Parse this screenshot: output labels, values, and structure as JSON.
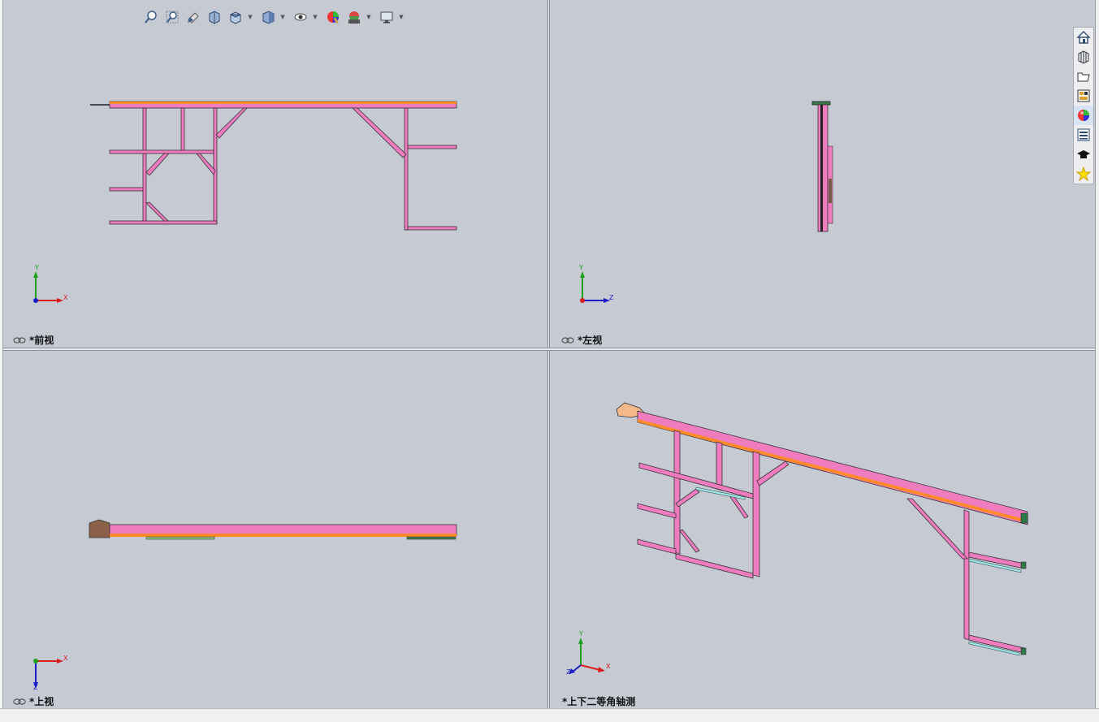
{
  "viewports": {
    "front": {
      "label": "*前视",
      "axis_h": "X",
      "axis_v": "Y"
    },
    "left": {
      "label": "*左视",
      "axis_h": "Z",
      "axis_v": "Y"
    },
    "top": {
      "label": "*上视",
      "axis_h": "X",
      "axis_v": "Z"
    },
    "iso": {
      "label": "*上下二等角轴测",
      "axis_x": "X",
      "axis_y": "Y",
      "axis_z": "Z"
    }
  },
  "toolbar": {
    "icons": [
      "zoom-to-fit-icon",
      "zoom-to-area-icon",
      "previous-view-icon",
      "section-view-icon",
      "view-orientation-icon",
      "display-style-icon",
      "hide-show-items-icon",
      "edit-appearance-icon",
      "apply-scene-icon",
      "view-settings-icon"
    ]
  },
  "task_pane": {
    "icons": [
      "home-icon",
      "design-library-icon",
      "file-explorer-icon",
      "view-palette-icon",
      "appearances-icon",
      "custom-properties-icon",
      "tutorials-icon",
      "favorites-icon"
    ]
  },
  "colors": {
    "background": "#c5cad3",
    "frame_member": "#f07cc0",
    "top_rail": "#ff8a2a",
    "axis_x": "#d81e1e",
    "axis_y": "#1ea01e",
    "axis_z": "#1e1ec8"
  }
}
